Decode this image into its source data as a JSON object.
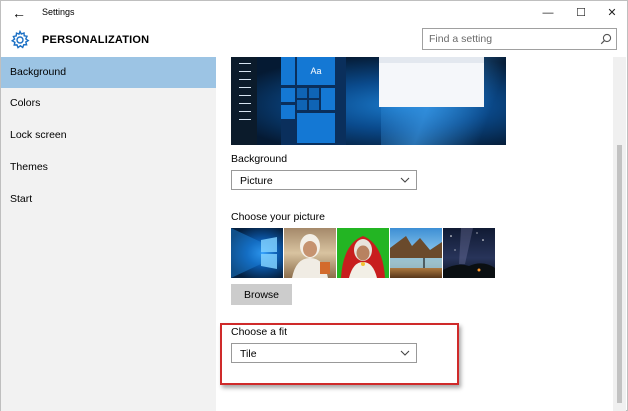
{
  "window": {
    "title": "Settings",
    "back_glyph": "←",
    "controls": {
      "minimize": "—",
      "maximize": "☐",
      "close": "✕"
    }
  },
  "header": {
    "icon": "gear-icon",
    "title": "PERSONALIZATION",
    "search_placeholder": "Find a setting"
  },
  "sidebar": {
    "items": [
      {
        "label": "Background",
        "active": true
      },
      {
        "label": "Colors",
        "active": false
      },
      {
        "label": "Lock screen",
        "active": false
      },
      {
        "label": "Themes",
        "active": false
      },
      {
        "label": "Start",
        "active": false
      }
    ]
  },
  "content": {
    "preview_tile_text": "Aa",
    "background_label": "Background",
    "background_value": "Picture",
    "choose_picture_label": "Choose your picture",
    "pictures": [
      "windows-hero-thumbnail",
      "portrait-thumbnail",
      "green-portrait-thumbnail",
      "beach-thumbnail",
      "night-sky-thumbnail"
    ],
    "browse_label": "Browse",
    "fit_label": "Choose a fit",
    "fit_value": "Tile"
  },
  "colors": {
    "accent_selected": "#9cc4e4",
    "highlight_box": "#cf2a2a",
    "sidebar_bg": "#f2f2f2"
  }
}
